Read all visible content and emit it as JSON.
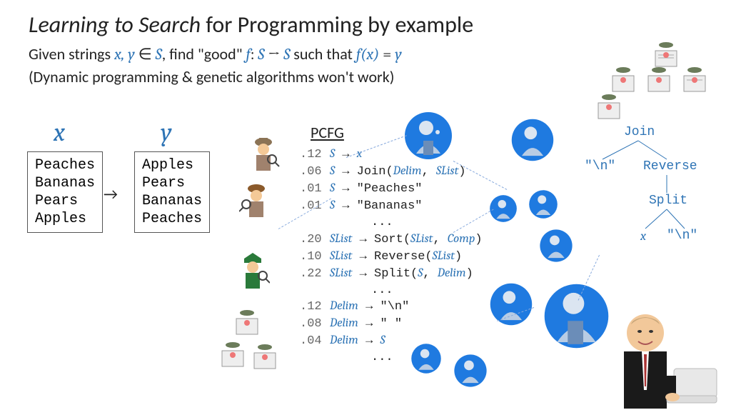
{
  "title_italic": "Learning to Search",
  "title_rest": " for Programming by example",
  "sub_pre": "Given strings ",
  "sub_xy": "x, y",
  "sub_in": " ∈ ",
  "sub_S": "S",
  "sub_find": ", find \"good\" ",
  "sub_f": "f",
  "sub_colon": ": ",
  "sub_S2": "S",
  "sub_to": " → ",
  "sub_S3": "S",
  "sub_such": " such that ",
  "sub_fx": "f(x)",
  "sub_eq": " = ",
  "sub_y": "y",
  "subtitle2": "(Dynamic programming & genetic algorithms won't work)",
  "xlabel": "x",
  "ylabel": "y",
  "xbox": "Peaches\nBananas\nPears\nApples",
  "ybox": "Apples\nPears\nBananas\nPeaches",
  "arrow_xy": "→",
  "pcfg_title": "PCFG",
  "pcfg": [
    {
      "w": ".12",
      "lhs": "S",
      "rhs_raw": "x",
      "rhs_nt": true
    },
    {
      "w": ".06",
      "lhs": "S",
      "rhs_raw": "Join(<nt>Delim</nt>, <nt>SList</nt>)"
    },
    {
      "w": ".01",
      "lhs": "S",
      "rhs_raw": "\"Peaches\""
    },
    {
      "w": ".01",
      "lhs": "S",
      "rhs_raw": "\"Bananas\""
    },
    {
      "dots": true
    },
    {
      "w": ".20",
      "lhs": "SList",
      "rhs_raw": "Sort(<nt>SList</nt>, <nt>Comp</nt>)"
    },
    {
      "w": ".10",
      "lhs": "SList",
      "rhs_raw": "Reverse(<nt>SList</nt>)"
    },
    {
      "w": ".22",
      "lhs": "SList",
      "rhs_raw": "Split(<nt>S</nt>, <nt>Delim</nt>)"
    },
    {
      "dots": true
    },
    {
      "w": ".12",
      "lhs": "Delim",
      "rhs_raw": "\"\\n\""
    },
    {
      "w": ".08",
      "lhs": "Delim",
      "rhs_raw": "\" \""
    },
    {
      "w": ".04",
      "lhs": "Delim",
      "rhs_raw": "<nt>S</nt>"
    },
    {
      "dots": true
    }
  ],
  "tree": {
    "n0": "Join",
    "n1": "\"\\n\"",
    "n2": "Reverse",
    "n3": "Split",
    "n4": "x",
    "n5": "\"\\n\""
  }
}
